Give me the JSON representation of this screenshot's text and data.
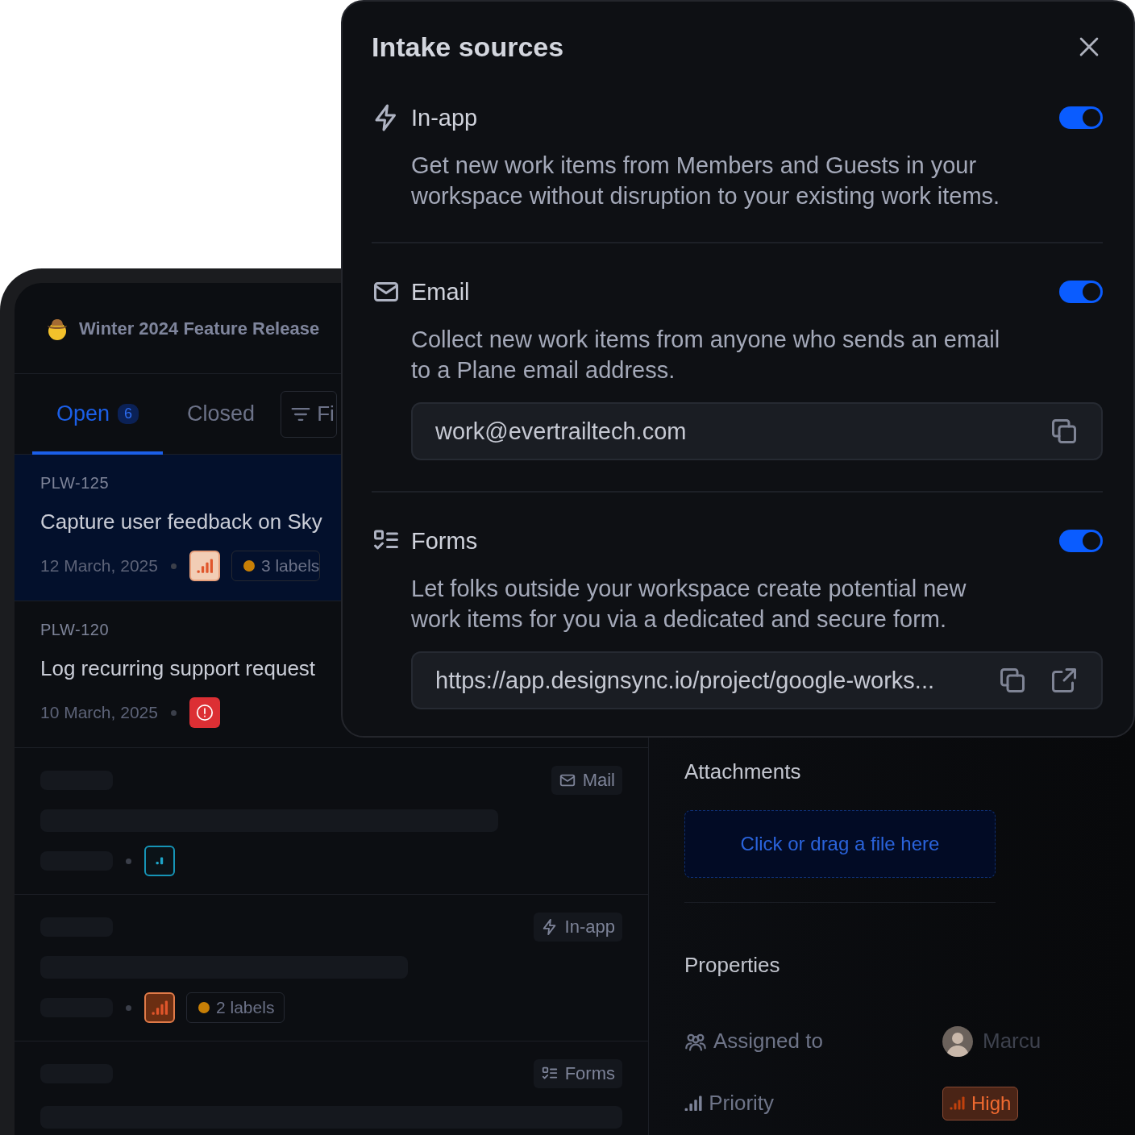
{
  "header": {
    "title": "Winter 2024 Feature Release"
  },
  "tabs": [
    {
      "label": "Open",
      "count": "6",
      "selected": true
    },
    {
      "label": "Closed",
      "selected": false
    }
  ],
  "filter_button": {
    "label": "Fi"
  },
  "issues": [
    {
      "kind": "issue",
      "id": "PLW-125",
      "title": "Capture user feedback on Sky",
      "date": "12 March, 2025",
      "priority": {
        "kind": "high"
      },
      "labels": "3 labels",
      "selected": true
    },
    {
      "kind": "issue",
      "id": "PLW-120",
      "title": "Log recurring support request",
      "date": "10 March, 2025",
      "priority": {
        "kind": "urgent"
      },
      "selected": false
    },
    {
      "kind": "placeholder",
      "source": {
        "kind": "mail",
        "label": "Mail"
      },
      "priority": {
        "kind": "low"
      },
      "selected": false
    },
    {
      "kind": "placeholder",
      "source": {
        "kind": "in_app",
        "label": "In-app"
      },
      "priority": {
        "kind": "high"
      },
      "labels": "2 labels",
      "selected": false
    },
    {
      "kind": "placeholder",
      "source": {
        "kind": "forms",
        "label": "Forms"
      },
      "selected": false
    }
  ],
  "detail": {
    "attachments": {
      "heading": "Attachments",
      "dropzone": "Click or drag a file here"
    },
    "properties": {
      "heading": "Properties",
      "items": [
        {
          "kind": "assignee",
          "label": "Assigned to",
          "value": "Marcu"
        },
        {
          "kind": "priority",
          "label": "Priority",
          "value": "High"
        }
      ]
    }
  },
  "modal": {
    "title": "Intake sources",
    "sources": [
      {
        "kind": "in_app",
        "label": "In-app",
        "on": true,
        "description": "Get new work items from Members and Guests in your workspace without disruption to your existing work items."
      },
      {
        "kind": "email",
        "label": "Email",
        "on": true,
        "description": "Collect new work items from anyone who sends an email to a Plane email address.",
        "field": {
          "kind": "email",
          "value": "work@evertrailtech.com"
        }
      },
      {
        "kind": "forms",
        "label": "Forms",
        "on": true,
        "description": "Let folks outside your workspace create potential new work items for you via a dedicated and secure form.",
        "field": {
          "kind": "url",
          "value": "https://app.designsync.io/project/google-works..."
        }
      }
    ]
  }
}
